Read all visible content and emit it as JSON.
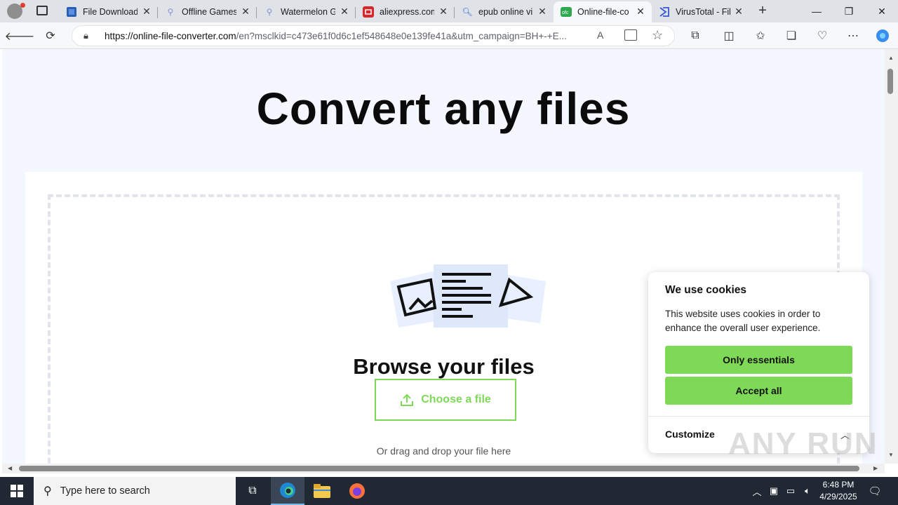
{
  "browser": {
    "tabs": [
      {
        "title": "File Download",
        "icon": "word-icon"
      },
      {
        "title": "Offline Games",
        "icon": "site-icon"
      },
      {
        "title": "Watermelon G",
        "icon": "site-icon"
      },
      {
        "title": "aliexpress.com",
        "icon": "aliexpress-icon"
      },
      {
        "title": "epub online vi",
        "icon": "search-icon"
      },
      {
        "title": "Online-file-co",
        "icon": "ofc-icon"
      },
      {
        "title": "VirusTotal - Fil",
        "icon": "virustotal-icon"
      }
    ],
    "active_tab": 5,
    "url_host": "https://online-file-converter.com",
    "url_rest": "/en?msclkid=c473e61f0d6c1ef548648e0e139fe41a&utm_campaign=BH+-+E..."
  },
  "page": {
    "hero_title": "Convert any files",
    "browse_title": "Browse your files",
    "choose_button": "Choose a file",
    "drag_hint": "Or drag and drop your file here"
  },
  "cookie": {
    "title": "We use cookies",
    "text": "This website uses cookies in order to enhance the overall user experience.",
    "essentials_button": "Only essentials",
    "accept_button": "Accept all",
    "customize": "Customize"
  },
  "watermark": "ANY RUN",
  "taskbar": {
    "search_placeholder": "Type here to search",
    "time": "6:48 PM",
    "date": "4/29/2025"
  },
  "colors": {
    "accent_green": "#7ed957",
    "page_bg": "#f4f7ff",
    "taskbar_bg": "#1f2833"
  }
}
